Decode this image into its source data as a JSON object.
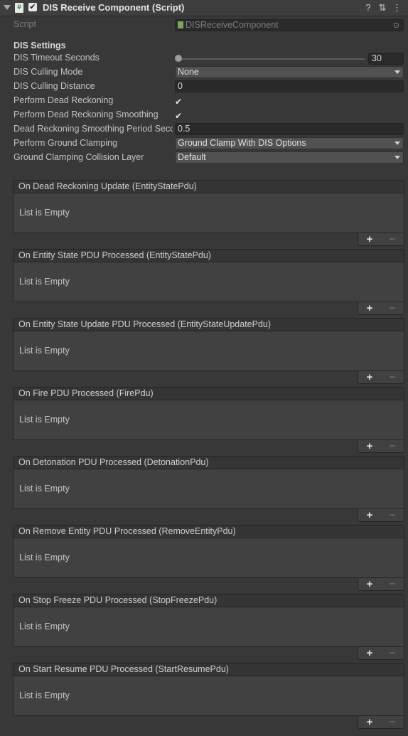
{
  "component": {
    "title": "DIS Receive Component (Script)",
    "script_label": "Script",
    "script_value": "DISReceiveComponent"
  },
  "settings": {
    "section_title": "DIS Settings",
    "timeout_label": "DIS Timeout Seconds",
    "timeout_value": "30",
    "culling_mode_label": "DIS Culling Mode",
    "culling_mode_value": "None",
    "culling_distance_label": "DIS Culling Distance",
    "culling_distance_value": "0",
    "dead_reckoning_label": "Perform Dead Reckoning",
    "dead_reckoning_checked": true,
    "dr_smoothing_label": "Perform Dead Reckoning Smoothing",
    "dr_smoothing_checked": true,
    "smoothing_period_label": "Dead Reckoning Smoothing Period Seco",
    "smoothing_period_value": "0.5",
    "ground_clamping_label": "Perform Ground Clamping",
    "ground_clamping_value": "Ground Clamp With DIS Options",
    "collision_layer_label": "Ground Clamping Collision Layer",
    "collision_layer_value": "Default"
  },
  "events": [
    {
      "title": "On Dead Reckoning Update (EntityStatePdu)",
      "empty_text": "List is Empty"
    },
    {
      "title": "On Entity State PDU Processed (EntityStatePdu)",
      "empty_text": "List is Empty"
    },
    {
      "title": "On Entity State Update PDU Processed (EntityStateUpdatePdu)",
      "empty_text": "List is Empty"
    },
    {
      "title": "On Fire PDU Processed (FirePdu)",
      "empty_text": "List is Empty"
    },
    {
      "title": "On Detonation PDU Processed (DetonationPdu)",
      "empty_text": "List is Empty"
    },
    {
      "title": "On Remove Entity PDU Processed (RemoveEntityPdu)",
      "empty_text": "List is Empty"
    },
    {
      "title": "On Stop Freeze PDU Processed (StopFreezePdu)",
      "empty_text": "List is Empty"
    },
    {
      "title": "On Start Resume PDU Processed (StartResumePdu)",
      "empty_text": "List is Empty"
    }
  ],
  "list_controls": {
    "add": "+",
    "remove": "−"
  },
  "icons": {
    "help": "?",
    "presets": "⇅",
    "menu": "⋮",
    "check": "✔"
  }
}
